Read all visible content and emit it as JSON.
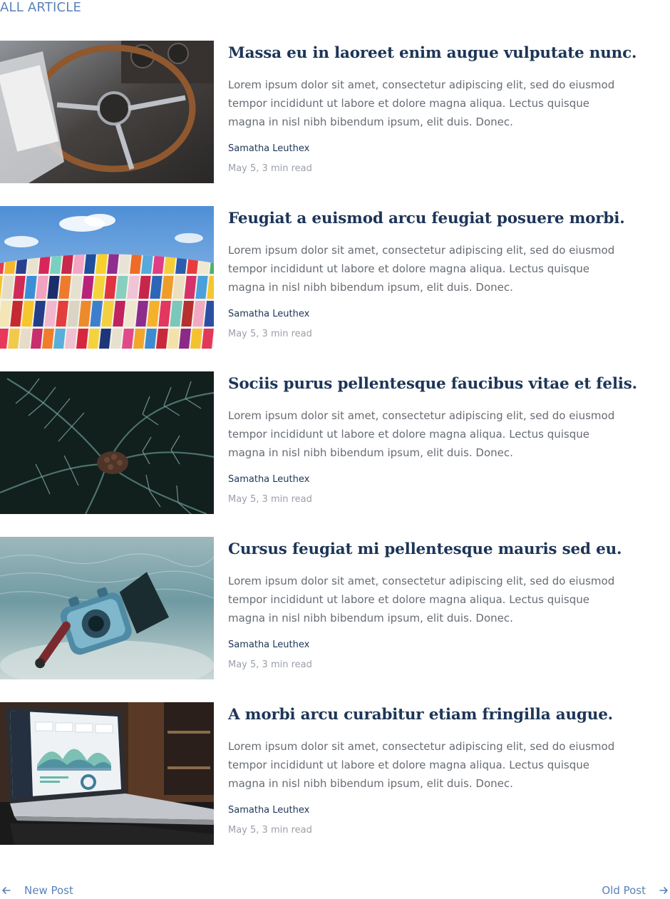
{
  "section": {
    "title": "ALL ARTICLE"
  },
  "articles": [
    {
      "title": "Massa eu in laoreet enim augue vulputate nunc.",
      "excerpt": "Lorem ipsum dolor sit amet, consectetur adipiscing elit, sed do eiusmod tempor incididunt ut labore et dolore magna aliqua. Lectus quisque magna in nisl nibh bibendum ipsum, elit duis. Donec.",
      "author": "Samatha Leuthex",
      "meta": "May 5, 3 min read",
      "image": "car-steering-wheel"
    },
    {
      "title": "Feugiat a euismod arcu feugiat posuere morbi.",
      "excerpt": "Lorem ipsum dolor sit amet, consectetur adipiscing elit, sed do eiusmod tempor incididunt ut labore et dolore magna aliqua. Lectus quisque magna in nisl nibh bibendum ipsum, elit duis. Donec.",
      "author": "Samatha Leuthex",
      "meta": "May 5, 3 min read",
      "image": "colorful-building-facade"
    },
    {
      "title": "Sociis purus pellentesque faucibus vitae et felis.",
      "excerpt": "Lorem ipsum dolor sit amet, consectetur adipiscing elit, sed do eiusmod tempor incididunt ut labore et dolore magna aliqua. Lectus quisque magna in nisl nibh bibendum ipsum, elit duis. Donec.",
      "author": "Samatha Leuthex",
      "meta": "May 5, 3 min read",
      "image": "palm-leaves"
    },
    {
      "title": "Cursus feugiat mi pellentesque mauris sed eu.",
      "excerpt": "Lorem ipsum dolor sit amet, consectetur adipiscing elit, sed do eiusmod tempor incididunt ut labore et dolore magna aliqua. Lectus quisque magna in nisl nibh bibendum ipsum, elit duis. Donec.",
      "author": "Samatha Leuthex",
      "meta": "May 5, 3 min read",
      "image": "underwater-camera"
    },
    {
      "title": "A morbi arcu curabitur etiam fringilla augue.",
      "excerpt": "Lorem ipsum dolor sit amet, consectetur adipiscing elit, sed do eiusmod tempor incididunt ut labore et dolore magna aliqua. Lectus quisque magna in nisl nibh bibendum ipsum, elit duis. Donec.",
      "author": "Samatha Leuthex",
      "meta": "May 5, 3 min read",
      "image": "laptop-dashboard"
    }
  ],
  "pager": {
    "prev_label": "New Post",
    "next_label": "Old Post",
    "prev_icon": "arrow-left-icon",
    "next_icon": "arrow-right-icon"
  },
  "colors": {
    "accent": "#5b82b8",
    "title": "#1d3557",
    "body_text": "#666c74",
    "muted": "#9aa0a8"
  }
}
